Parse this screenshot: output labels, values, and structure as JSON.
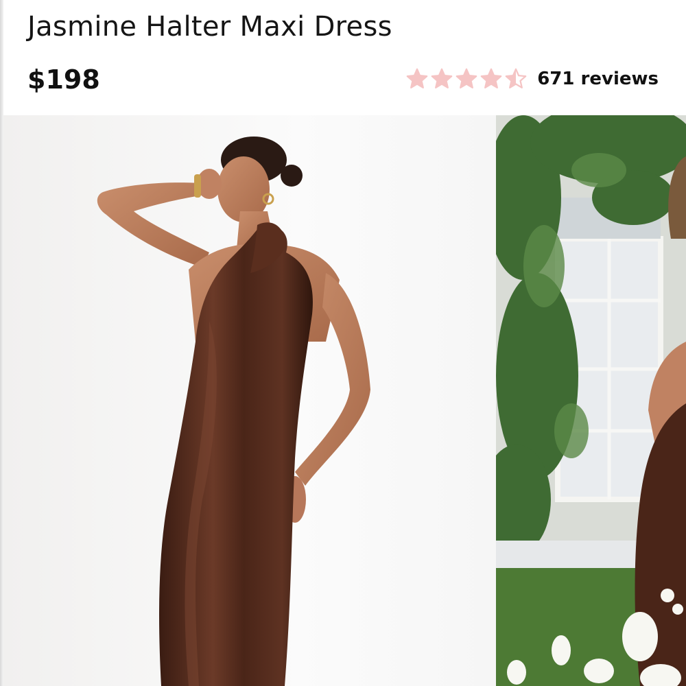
{
  "product": {
    "title": "Jasmine Halter Maxi Dress",
    "price": "$198",
    "rating": 4.5,
    "rating_max": 5,
    "reviews_label": "671 reviews"
  },
  "colors": {
    "star": "#f5c4c4",
    "text": "#111111",
    "dress": "#4a2518"
  },
  "gallery": {
    "images": [
      {
        "name": "model-studio-front",
        "alt": "Model wearing brown satin halter maxi dress, studio"
      },
      {
        "name": "model-outdoor-ivy",
        "alt": "Model in brown halter dress holding white flowers in front of ivy-covered building"
      }
    ]
  }
}
